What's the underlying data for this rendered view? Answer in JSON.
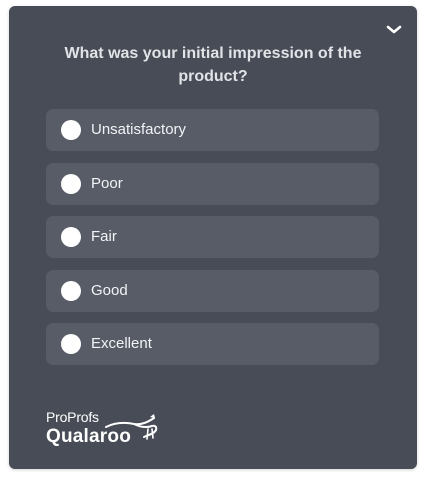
{
  "survey": {
    "question": "What was your initial impression of the product?",
    "collapse_icon": "chevron-down-icon",
    "options": [
      {
        "label": "Unsatisfactory"
      },
      {
        "label": "Poor"
      },
      {
        "label": "Fair"
      },
      {
        "label": "Good"
      },
      {
        "label": "Excellent"
      }
    ]
  },
  "branding": {
    "line1": "ProProfs",
    "line2": "Qualaroo",
    "logo_icon": "qualaroo-kangaroo-logo"
  },
  "colors": {
    "panel": "#474c56",
    "option": "#575c67",
    "text": "#f2f3f5"
  }
}
